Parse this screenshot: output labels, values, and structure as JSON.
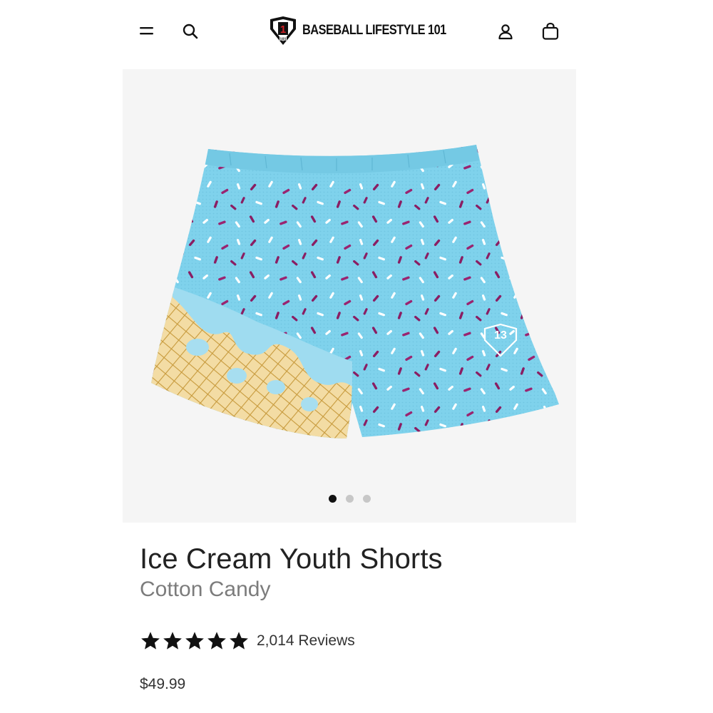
{
  "header": {
    "brand_name": "BASEBALL LIFESTYLE 101",
    "menu_icon": "hamburger-menu-icon",
    "search_icon": "search-icon",
    "account_icon": "user-account-icon",
    "cart_icon": "shopping-bag-icon"
  },
  "gallery": {
    "current_image": 1,
    "image_count": 3
  },
  "product": {
    "name": "Ice Cream Youth Shorts",
    "variant": "Cotton Candy",
    "rating": 5,
    "reviews_label": "2,014 Reviews",
    "price": "$49.99"
  },
  "colors": {
    "shorts_blue": "#7fd2ec",
    "sprinkle_purple": "#8a1e63",
    "cone_tan": "#f3d9a0"
  }
}
